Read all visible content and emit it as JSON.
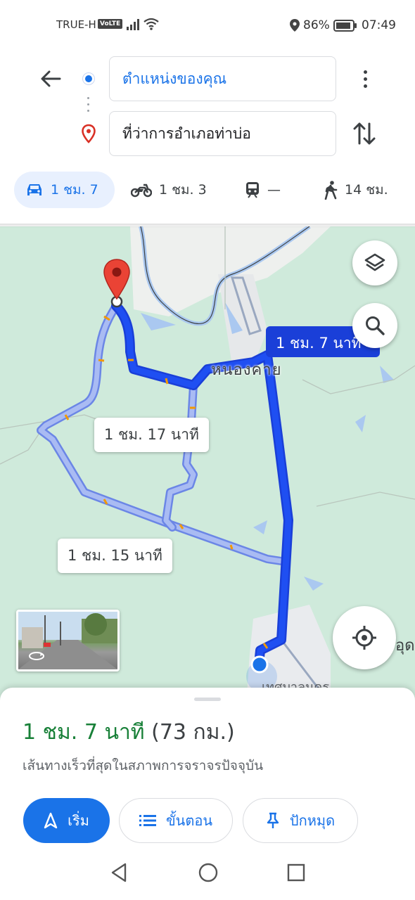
{
  "status_bar": {
    "carrier": "TRUE-H",
    "volte": "VoLTE",
    "battery": "86%",
    "time": "07:49"
  },
  "directions": {
    "origin": "ตำแหน่งของคุณ",
    "destination": "ที่ว่าการอำเภอท่าบ่อ"
  },
  "modes": [
    {
      "name": "car",
      "label": "1 ชม. 7",
      "active": true
    },
    {
      "name": "motorcycle",
      "label": "1 ชม. 3"
    },
    {
      "name": "transit",
      "label": "—"
    },
    {
      "name": "walk",
      "label": "14 ชม."
    }
  ],
  "map": {
    "route_labels": {
      "selected": "1 ชม. 7 นาที",
      "alt1": "1 ชม. 17 นาที",
      "alt2": "1 ชม. 15 นาที"
    },
    "place_names": {
      "nong_khai": "หนองคาย",
      "town_bottom": "เทศบาลนคร",
      "edge_right": "อุด"
    }
  },
  "sheet": {
    "duration": "1 ชม. 7 นาที",
    "distance": "(73 กม.)",
    "description": "เส้นทางเร็วที่สุดในสภาพการจราจรปัจจุบัน",
    "buttons": {
      "start": "เริ่ม",
      "steps": "ขั้นตอน",
      "pin": "ปักหมุด"
    }
  },
  "colors": {
    "accent": "#1a73e8",
    "duration_green": "#188038",
    "route_selected": "#1a3fd8",
    "route_alt": "#9fb4f0",
    "map_bg": "#cfeadb",
    "water": "#aac8f0"
  }
}
